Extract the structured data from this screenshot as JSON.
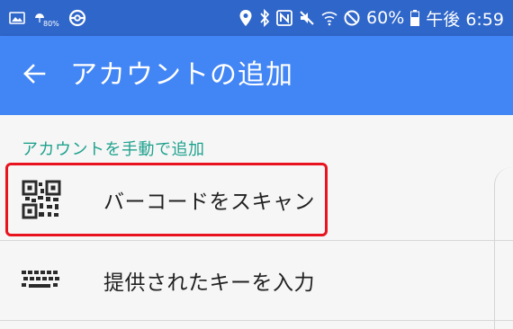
{
  "status_bar": {
    "left_icons": [
      "gallery-icon",
      "rain-icon",
      "pokeball-icon"
    ],
    "rain_value": "80%",
    "right_icons": [
      "location-icon",
      "bluetooth-icon",
      "nfc-icon",
      "mute-icon",
      "wifi-icon",
      "no-sign-icon"
    ],
    "battery_percent": "60%",
    "time": "午後 6:59"
  },
  "app_bar": {
    "title": "アカウントの追加",
    "back_icon": "arrow-back-icon"
  },
  "section": {
    "header": "アカウントを手動で追加"
  },
  "options": [
    {
      "label": "バーコードをスキャン",
      "icon": "qr-code-icon"
    },
    {
      "label": "提供されたキーを入力",
      "icon": "keyboard-icon"
    }
  ],
  "colors": {
    "status_bar": "#2f66c9",
    "app_bar": "#4285f4",
    "section_header": "#20a28e",
    "highlight_border": "#e8131e"
  }
}
